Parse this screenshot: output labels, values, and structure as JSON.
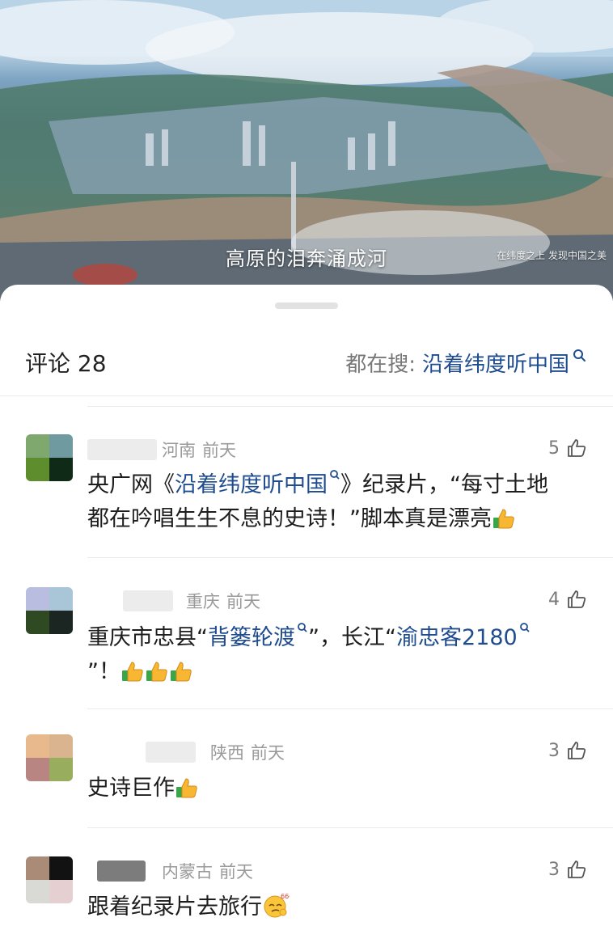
{
  "video": {
    "subtitle": "高原的泪奔涌成河",
    "watermark": "在纬度之上 发现中国之美"
  },
  "sheet": {
    "comments_label": "评论 28",
    "search_prefix": "都在搜:",
    "search_keyword": "沿着纬度听中国"
  },
  "comments": [
    {
      "location": "河南",
      "time": "前天",
      "likes": "5",
      "text_a": "央广网《",
      "link_a": "沿着纬度听中国",
      "text_b": "》纪录片，“每寸土地",
      "text_c": "都在吟唱生生不息的史诗！”脚本真是漂亮",
      "emoji": "thumbs-up"
    },
    {
      "location": "重庆",
      "time": "前天",
      "likes": "4",
      "text_a": "重庆市忠县“",
      "link_a": "背篓轮渡",
      "text_b": "”，长江“",
      "link_b": "渝忠客2180",
      "text_c": "”！",
      "emoji": "thumbs-up x3"
    },
    {
      "location": "陕西",
      "time": "前天",
      "likes": "3",
      "text_a": "史诗巨作",
      "emoji": "thumbs-up"
    },
    {
      "location": "内蒙古",
      "time": "前天",
      "likes": "3",
      "text_a": "跟着纪录片去旅行",
      "emoji": "666-face",
      "emoji_label": "666"
    }
  ],
  "colors": {
    "link": "#1f4c8f",
    "meta": "#9a9a9a",
    "text": "#1d1d1d"
  }
}
